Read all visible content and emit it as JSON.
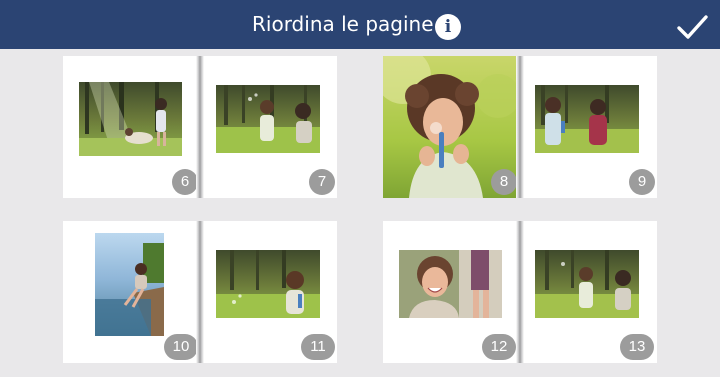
{
  "header": {
    "title": "Riordina le pagine",
    "info_icon": "info-icon",
    "confirm_icon": "checkmark-icon",
    "background_color": "#2b4473"
  },
  "spreads": [
    {
      "pages": [
        {
          "number": "6",
          "photo": "girl-dog-meadow"
        },
        {
          "number": "7",
          "photo": "girl-bubbles-field"
        }
      ]
    },
    {
      "pages": [
        {
          "number": "8",
          "photo": "girl-blowing-bubbles-closeup"
        },
        {
          "number": "9",
          "photo": "girls-bubbles-outdoors"
        }
      ]
    },
    {
      "pages": [
        {
          "number": "10",
          "photo": "girl-dock-lake"
        },
        {
          "number": "11",
          "photo": "girl-bubble-wand-grass"
        }
      ]
    },
    {
      "pages": [
        {
          "number": "12",
          "photo": "laughing-girl-with-mom"
        },
        {
          "number": "13",
          "photo": "girl-bubbles-trees"
        }
      ]
    }
  ]
}
